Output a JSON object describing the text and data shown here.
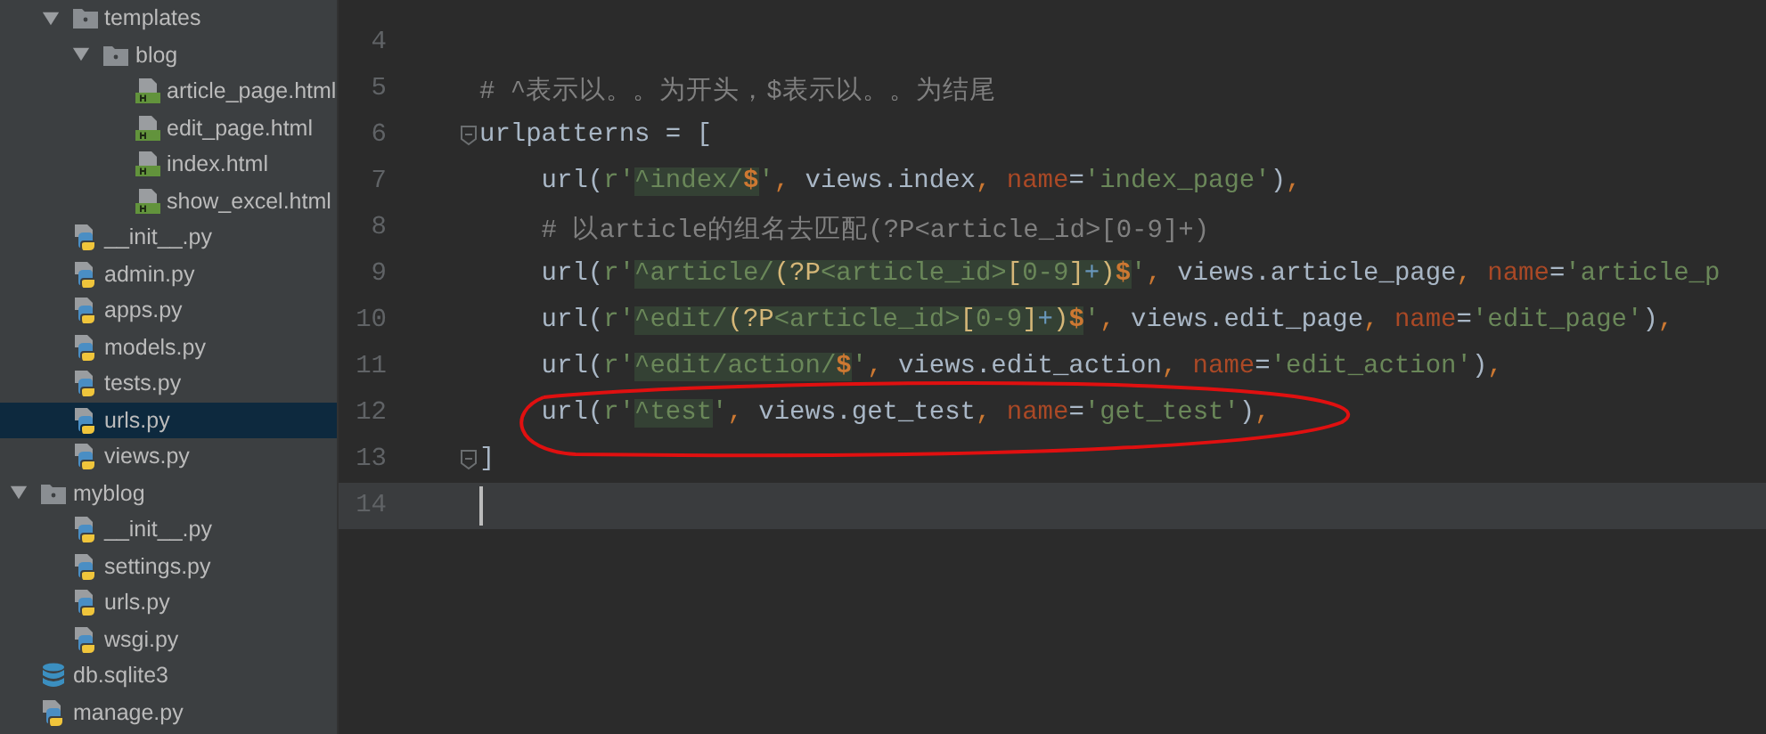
{
  "project_tree": {
    "continued_children": [
      {
        "label": "templates",
        "kind": "folder",
        "expanded": true,
        "selected": false,
        "children": [
          {
            "label": "blog",
            "kind": "folder",
            "expanded": true,
            "selected": false,
            "children": [
              {
                "label": "article_page.html",
                "kind": "html",
                "selected": false
              },
              {
                "label": "edit_page.html",
                "kind": "html",
                "selected": false
              },
              {
                "label": "index.html",
                "kind": "html",
                "selected": false
              },
              {
                "label": "show_excel.html",
                "kind": "html",
                "selected": false
              }
            ]
          }
        ]
      },
      {
        "label": "__init__.py",
        "kind": "py",
        "selected": false
      },
      {
        "label": "admin.py",
        "kind": "py",
        "selected": false
      },
      {
        "label": "apps.py",
        "kind": "py",
        "selected": false
      },
      {
        "label": "models.py",
        "kind": "py",
        "selected": false
      },
      {
        "label": "tests.py",
        "kind": "py",
        "selected": false
      },
      {
        "label": "urls.py",
        "kind": "py",
        "selected": true
      },
      {
        "label": "views.py",
        "kind": "py",
        "selected": false
      }
    ],
    "items": [
      {
        "label": "myblog",
        "kind": "folder",
        "expanded": true,
        "selected": false,
        "children": [
          {
            "label": "__init__.py",
            "kind": "py",
            "selected": false
          },
          {
            "label": "settings.py",
            "kind": "py",
            "selected": false
          },
          {
            "label": "urls.py",
            "kind": "py",
            "selected": false
          },
          {
            "label": "wsgi.py",
            "kind": "py",
            "selected": false
          }
        ]
      },
      {
        "label": "db.sqlite3",
        "kind": "db",
        "selected": false
      },
      {
        "label": "manage.py",
        "kind": "py",
        "selected": false
      }
    ]
  },
  "editor": {
    "lines": [
      {
        "number": "4",
        "fold": false,
        "current": false
      },
      {
        "number": "5",
        "fold": false,
        "current": false,
        "segments": [
          {
            "kind": "comment",
            "text": "# ^表示以。。为开头，$表示以。。为结尾"
          }
        ]
      },
      {
        "number": "6",
        "fold": true,
        "current": false,
        "segments": [
          {
            "kind": "plain",
            "text": "urlpatterns = ["
          }
        ]
      },
      {
        "number": "7",
        "fold": false,
        "current": false,
        "segments": [
          {
            "kind": "plain",
            "text": "    url("
          },
          {
            "kind": "str",
            "text": "r'"
          },
          {
            "kind": "re",
            "text": "^index/"
          },
          {
            "kind": "re_end",
            "text": "$"
          },
          {
            "kind": "str",
            "text": "'"
          },
          {
            "kind": "kw",
            "text": ","
          },
          {
            "kind": "plain",
            "text": " views.index"
          },
          {
            "kind": "kw",
            "text": ","
          },
          {
            "kind": "param",
            "text": " name"
          },
          {
            "kind": "plain",
            "text": "="
          },
          {
            "kind": "str",
            "text": "'index_page'"
          },
          {
            "kind": "plain",
            "text": ")"
          },
          {
            "kind": "kw",
            "text": ","
          }
        ]
      },
      {
        "number": "8",
        "fold": false,
        "current": false,
        "segments": [
          {
            "kind": "comment",
            "text": "    # 以article的组名去匹配(?P<article_id>[0-9]+)"
          }
        ]
      },
      {
        "number": "9",
        "fold": false,
        "current": false,
        "segments": [
          {
            "kind": "plain",
            "text": "    url("
          },
          {
            "kind": "str",
            "text": "r'"
          },
          {
            "kind": "re",
            "text": "^article/"
          },
          {
            "kind": "re_brace",
            "text": "(?P"
          },
          {
            "kind": "re",
            "text": "<article_id>"
          },
          {
            "kind": "re_brace",
            "text": "["
          },
          {
            "kind": "re",
            "text": "0-9"
          },
          {
            "kind": "re_brace",
            "text": "]"
          },
          {
            "kind": "re_op",
            "text": "+"
          },
          {
            "kind": "re_brace",
            "text": ")"
          },
          {
            "kind": "re_end",
            "text": "$"
          },
          {
            "kind": "str",
            "text": "'"
          },
          {
            "kind": "kw",
            "text": ","
          },
          {
            "kind": "plain",
            "text": " views.article_page"
          },
          {
            "kind": "kw",
            "text": ","
          },
          {
            "kind": "param",
            "text": " name"
          },
          {
            "kind": "plain",
            "text": "="
          },
          {
            "kind": "str",
            "text": "'article_p"
          }
        ]
      },
      {
        "number": "10",
        "fold": false,
        "current": false,
        "segments": [
          {
            "kind": "plain",
            "text": "    url("
          },
          {
            "kind": "str",
            "text": "r'"
          },
          {
            "kind": "re",
            "text": "^edit/"
          },
          {
            "kind": "re_brace",
            "text": "(?P"
          },
          {
            "kind": "re",
            "text": "<article_id>"
          },
          {
            "kind": "re_brace",
            "text": "["
          },
          {
            "kind": "re",
            "text": "0-9"
          },
          {
            "kind": "re_brace",
            "text": "]"
          },
          {
            "kind": "re_op",
            "text": "+"
          },
          {
            "kind": "re_brace",
            "text": ")"
          },
          {
            "kind": "re_end",
            "text": "$"
          },
          {
            "kind": "str",
            "text": "'"
          },
          {
            "kind": "kw",
            "text": ","
          },
          {
            "kind": "plain",
            "text": " views.edit_page"
          },
          {
            "kind": "kw",
            "text": ","
          },
          {
            "kind": "param",
            "text": " name"
          },
          {
            "kind": "plain",
            "text": "="
          },
          {
            "kind": "str",
            "text": "'edit_page'"
          },
          {
            "kind": "plain",
            "text": ")"
          },
          {
            "kind": "kw",
            "text": ","
          }
        ]
      },
      {
        "number": "11",
        "fold": false,
        "current": false,
        "segments": [
          {
            "kind": "plain",
            "text": "    url("
          },
          {
            "kind": "str",
            "text": "r'"
          },
          {
            "kind": "re",
            "text": "^edit/action/"
          },
          {
            "kind": "re_end",
            "text": "$"
          },
          {
            "kind": "str",
            "text": "'"
          },
          {
            "kind": "kw",
            "text": ","
          },
          {
            "kind": "plain",
            "text": " views.edit_action"
          },
          {
            "kind": "kw",
            "text": ","
          },
          {
            "kind": "param",
            "text": " name"
          },
          {
            "kind": "plain",
            "text": "="
          },
          {
            "kind": "str",
            "text": "'edit_action'"
          },
          {
            "kind": "plain",
            "text": ")"
          },
          {
            "kind": "kw",
            "text": ","
          }
        ]
      },
      {
        "number": "12",
        "fold": false,
        "current": false,
        "segments": [
          {
            "kind": "plain",
            "text": "    url("
          },
          {
            "kind": "str",
            "text": "r'"
          },
          {
            "kind": "re",
            "text": "^test"
          },
          {
            "kind": "str",
            "text": "'"
          },
          {
            "kind": "kw",
            "text": ","
          },
          {
            "kind": "plain",
            "text": " views.get_test"
          },
          {
            "kind": "kw",
            "text": ","
          },
          {
            "kind": "param",
            "text": " name"
          },
          {
            "kind": "plain",
            "text": "="
          },
          {
            "kind": "str",
            "text": "'get_test'"
          },
          {
            "kind": "plain",
            "text": ")"
          },
          {
            "kind": "kw",
            "text": ","
          }
        ]
      },
      {
        "number": "13",
        "fold": true,
        "current": false,
        "segments": [
          {
            "kind": "plain",
            "text": "]"
          }
        ]
      },
      {
        "number": "14",
        "fold": false,
        "current": true
      }
    ]
  }
}
